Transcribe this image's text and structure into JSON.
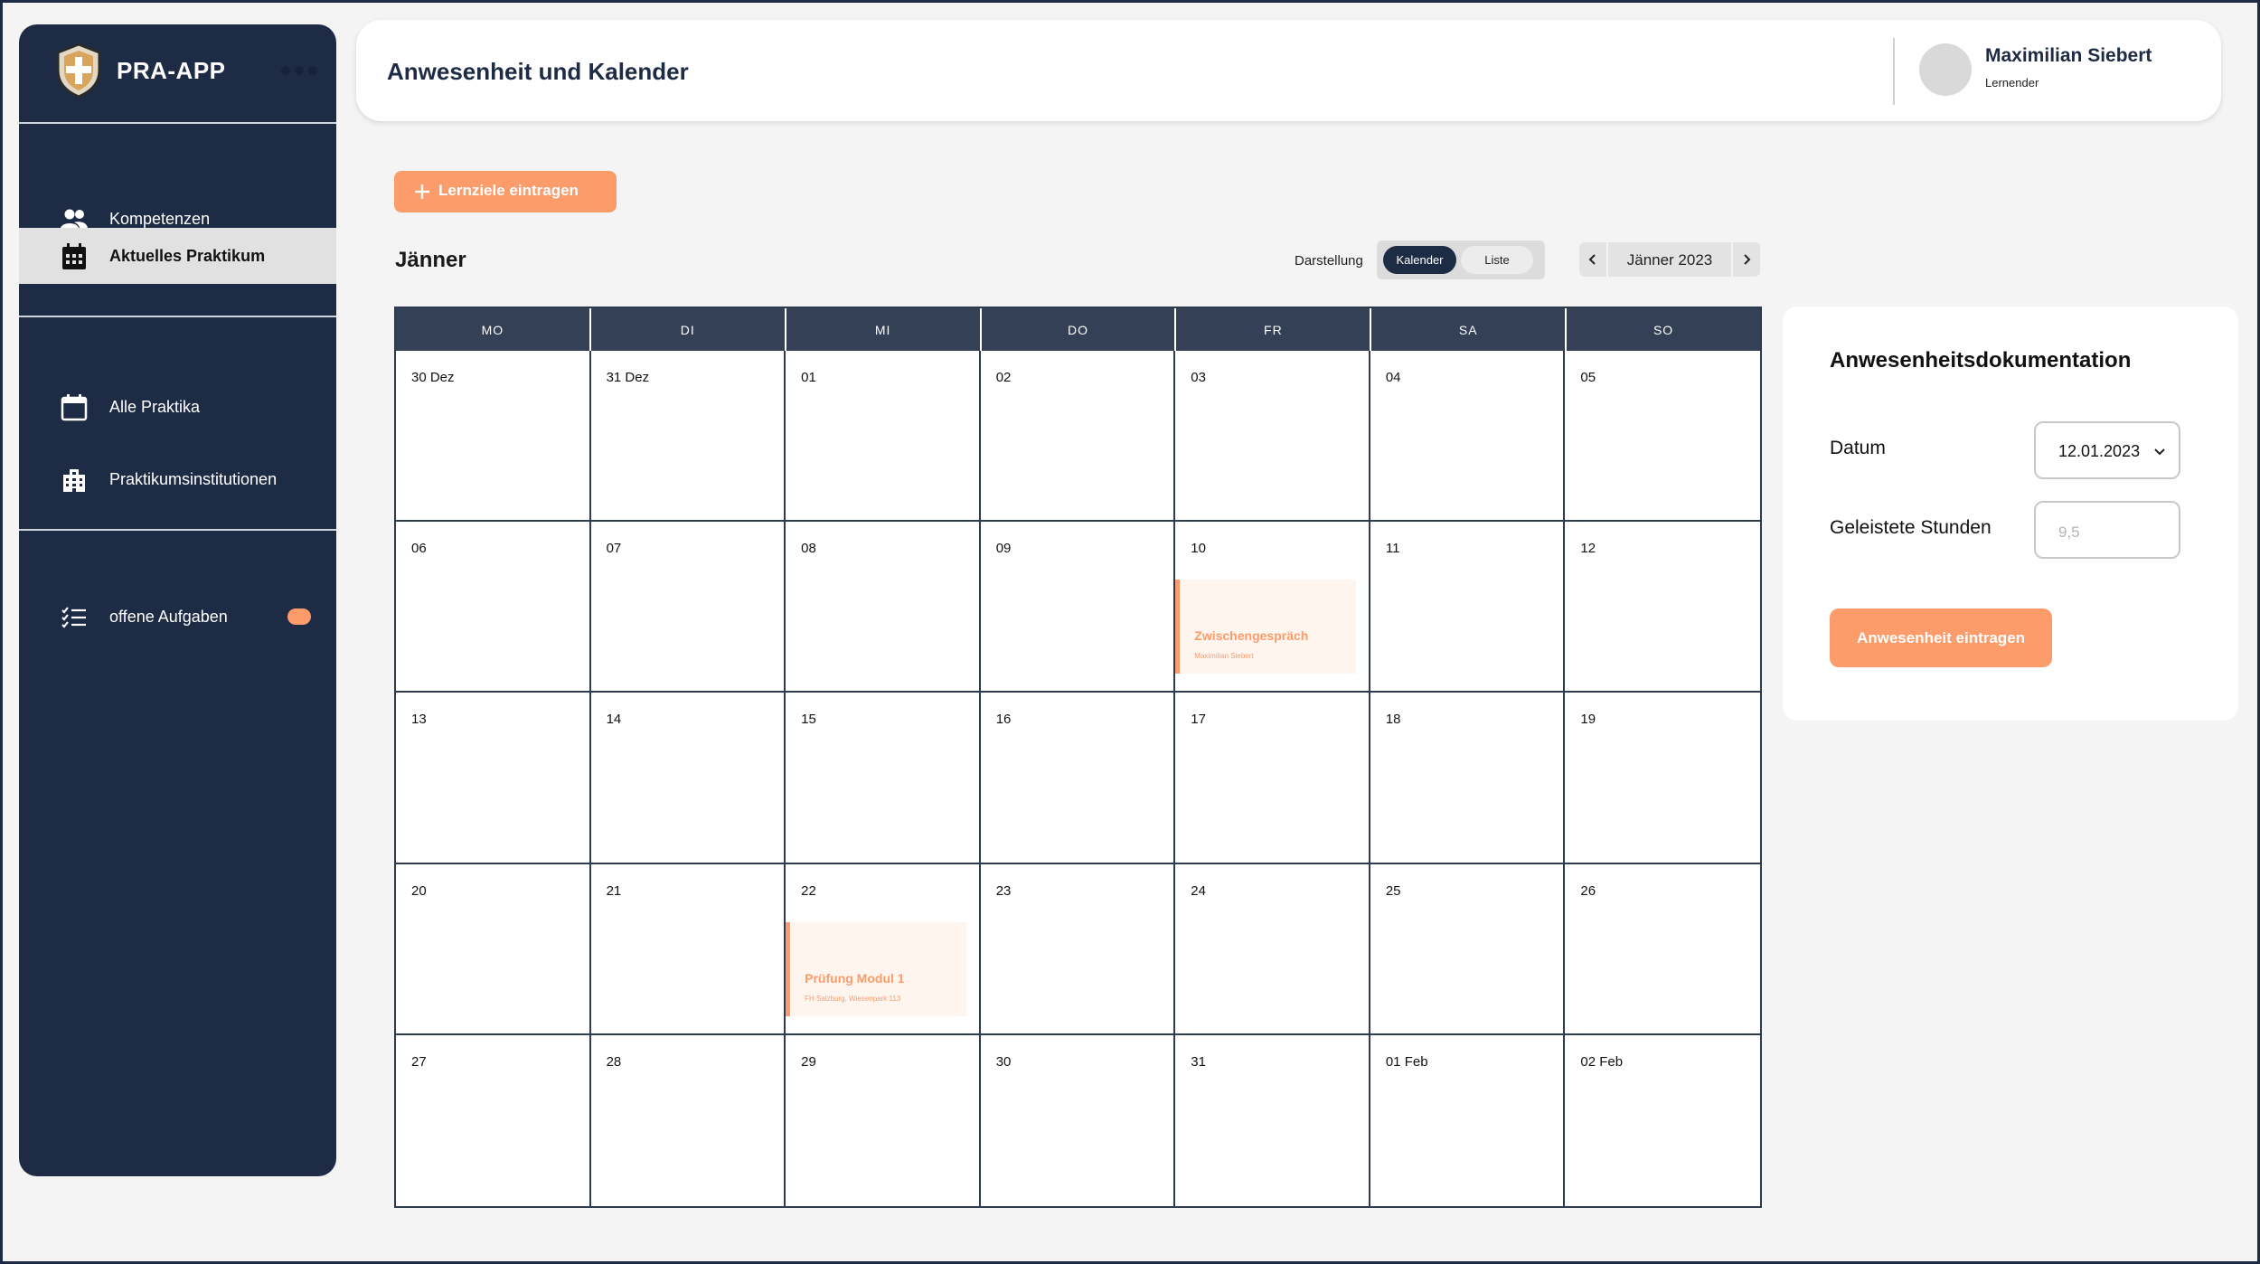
{
  "app": {
    "name": "PRA-APP"
  },
  "sidebar": {
    "items": [
      {
        "label": "Kompetenzen",
        "icon": "users-icon"
      },
      {
        "label": "Aktuelles Praktikum",
        "icon": "calendar-grid-icon",
        "active": true
      },
      {
        "label": "Alle Praktika",
        "icon": "calendar-icon"
      },
      {
        "label": "Praktikumsinstitutionen",
        "icon": "building-icon"
      },
      {
        "label": "offene Aufgaben",
        "icon": "checklist-icon",
        "badge_color": "#fc9c6b"
      }
    ]
  },
  "header": {
    "title": "Anwesenheit und Kalender",
    "user": {
      "name": "Maximilian Siebert",
      "role": "Lernender"
    }
  },
  "toolbar": {
    "add_button": "Lernziele eintragen",
    "month_title": "Jänner",
    "view_label": "Darstellung",
    "view_options": [
      "Kalender",
      "Liste"
    ],
    "view_selected": "Kalender",
    "month_nav": "Jänner 2023"
  },
  "calendar": {
    "weekdays": [
      "MO",
      "DI",
      "MI",
      "DO",
      "FR",
      "SA",
      "SO"
    ],
    "days": [
      "30 Dez",
      "31 Dez",
      "01",
      "02",
      "03",
      "04",
      "05",
      "06",
      "07",
      "08",
      "09",
      "10",
      "11",
      "12",
      "13",
      "14",
      "15",
      "16",
      "17",
      "18",
      "19",
      "20",
      "21",
      "22",
      "23",
      "24",
      "25",
      "26",
      "27",
      "28",
      "29",
      "30",
      "31",
      "01 Feb",
      "02 Feb"
    ],
    "events": [
      {
        "day_index": 11,
        "title": "Zwischengespräch",
        "subtitle": "Maximilian Siebert"
      },
      {
        "day_index": 23,
        "title": "Prüfung Modul 1",
        "subtitle": "FH Salzburg, Wiesenpark 113"
      }
    ]
  },
  "attendance": {
    "title": "Anwesenheitsdokumentation",
    "date_label": "Datum",
    "date_value": "12.01.2023",
    "hours_label": "Geleistete Stunden",
    "hours_placeholder": "9,5",
    "submit": "Anwesenheit eintragen"
  },
  "colors": {
    "accent": "#fc9c6b",
    "navy": "#1e2b45"
  }
}
